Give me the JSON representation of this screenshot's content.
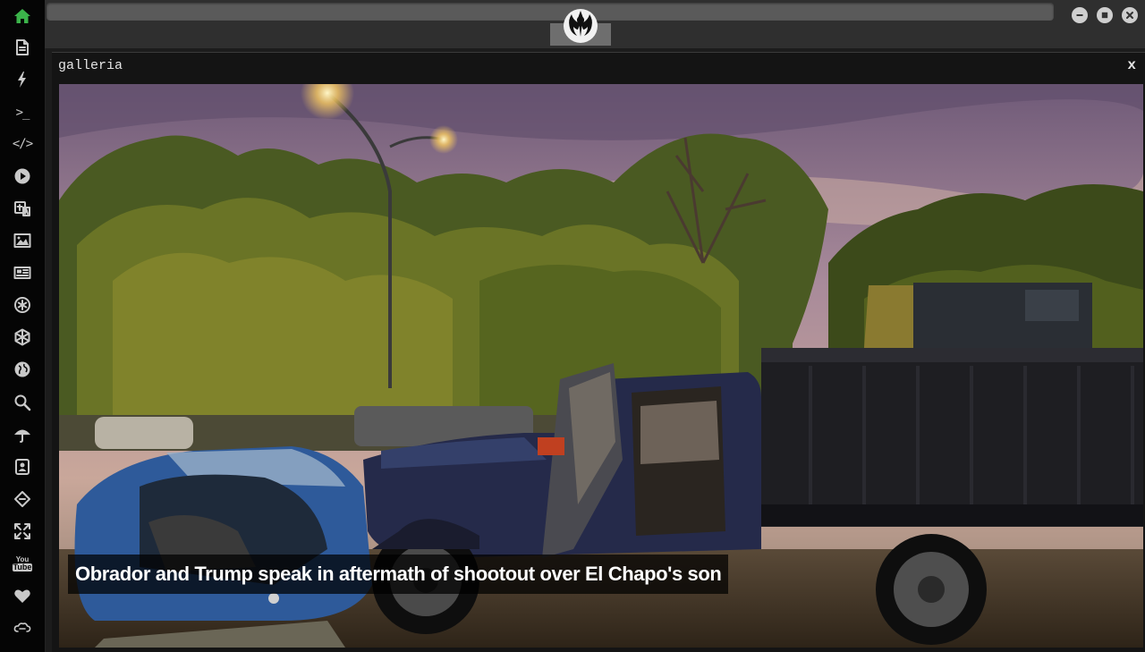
{
  "sidebar": {
    "items": [
      {
        "icon": "home-icon",
        "active": true
      },
      {
        "icon": "document-icon"
      },
      {
        "icon": "lightning-icon"
      },
      {
        "icon": "terminal-icon",
        "text": ">_"
      },
      {
        "icon": "code-icon",
        "text": "</>"
      },
      {
        "icon": "play-icon"
      },
      {
        "icon": "translate-icon"
      },
      {
        "icon": "image-icon"
      },
      {
        "icon": "newspaper-icon"
      },
      {
        "icon": "asterisk-icon"
      },
      {
        "icon": "hexagon-icon"
      },
      {
        "icon": "globe-icon"
      },
      {
        "icon": "search-icon"
      },
      {
        "icon": "umbrella-icon"
      },
      {
        "icon": "contact-card-icon"
      },
      {
        "icon": "diamond-link-icon"
      },
      {
        "icon": "expand-icon"
      },
      {
        "icon": "youtube-icon",
        "text_top": "You",
        "text_bottom": "Tube"
      },
      {
        "icon": "heart-icon"
      },
      {
        "icon": "cloud-link-icon"
      }
    ]
  },
  "window": {
    "controls": [
      "minimize-icon",
      "maximize-icon",
      "close-icon"
    ],
    "logo": "rebel-alliance-icon"
  },
  "gallery": {
    "title": "galleria",
    "close_label": "x",
    "caption": "Obrador and Trump speak in aftermath of shootout over El Chapo's son"
  },
  "colors": {
    "accent": "#3bb34a",
    "sidebar_bg": "#050505",
    "topbar_bg": "#2f2f2f",
    "panel_bg": "#141414"
  }
}
